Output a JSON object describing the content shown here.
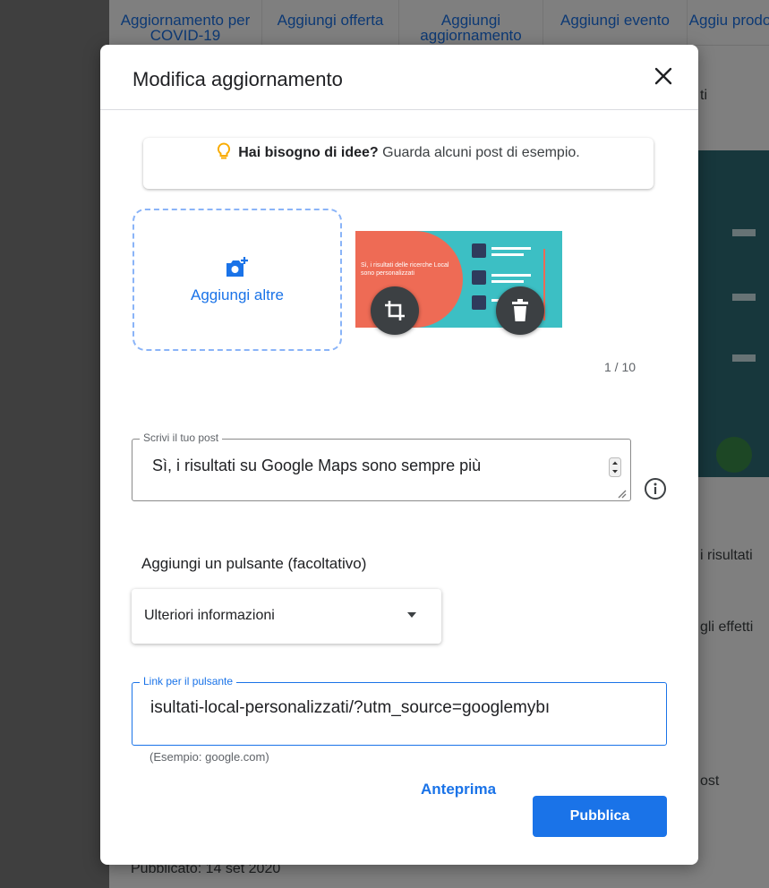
{
  "background": {
    "tabs": [
      {
        "label": "Aggiornamento per COVID-19"
      },
      {
        "label": "Aggiungi offerta"
      },
      {
        "label": "Aggiungi aggiornamento"
      },
      {
        "label": "Aggiungi evento"
      },
      {
        "label": "Aggiu prodo"
      }
    ],
    "side_texts": {
      "ti": "ti",
      "risultati": "i risultati",
      "effetti": "gli effetti",
      "post": "ost",
      "published": "Pubblicato: 14 set 2020"
    }
  },
  "dialog": {
    "title": "Modifica aggiornamento",
    "ideas": {
      "bold": "Hai bisogno di idee?",
      "text": "Guarda alcuni post di esempio."
    },
    "add_photo_label": "Aggiungi altre",
    "thumbnail_text": "Sì, i risultati delle ricerche Local sono personalizzati",
    "counter": "1 / 10",
    "post_field": {
      "legend": "Scrivi il tuo post",
      "value": "Sì, i risultati su Google Maps sono sempre più"
    },
    "button_section_label": "Aggiungi un pulsante (facoltativo)",
    "button_select_value": "Ulteriori informazioni",
    "link_field": {
      "legend": "Link per il pulsante",
      "value": "isultati-local-personalizzati/?utm_source=googlemybı"
    },
    "example_hint": "(Esempio: google.com)",
    "preview_label": "Anteprima",
    "publish_label": "Pubblica"
  },
  "colors": {
    "accent": "#1a73e8",
    "bulb": "#f9ab00",
    "thumb_coral": "#ee6b55",
    "thumb_teal": "#3cbfc4"
  }
}
